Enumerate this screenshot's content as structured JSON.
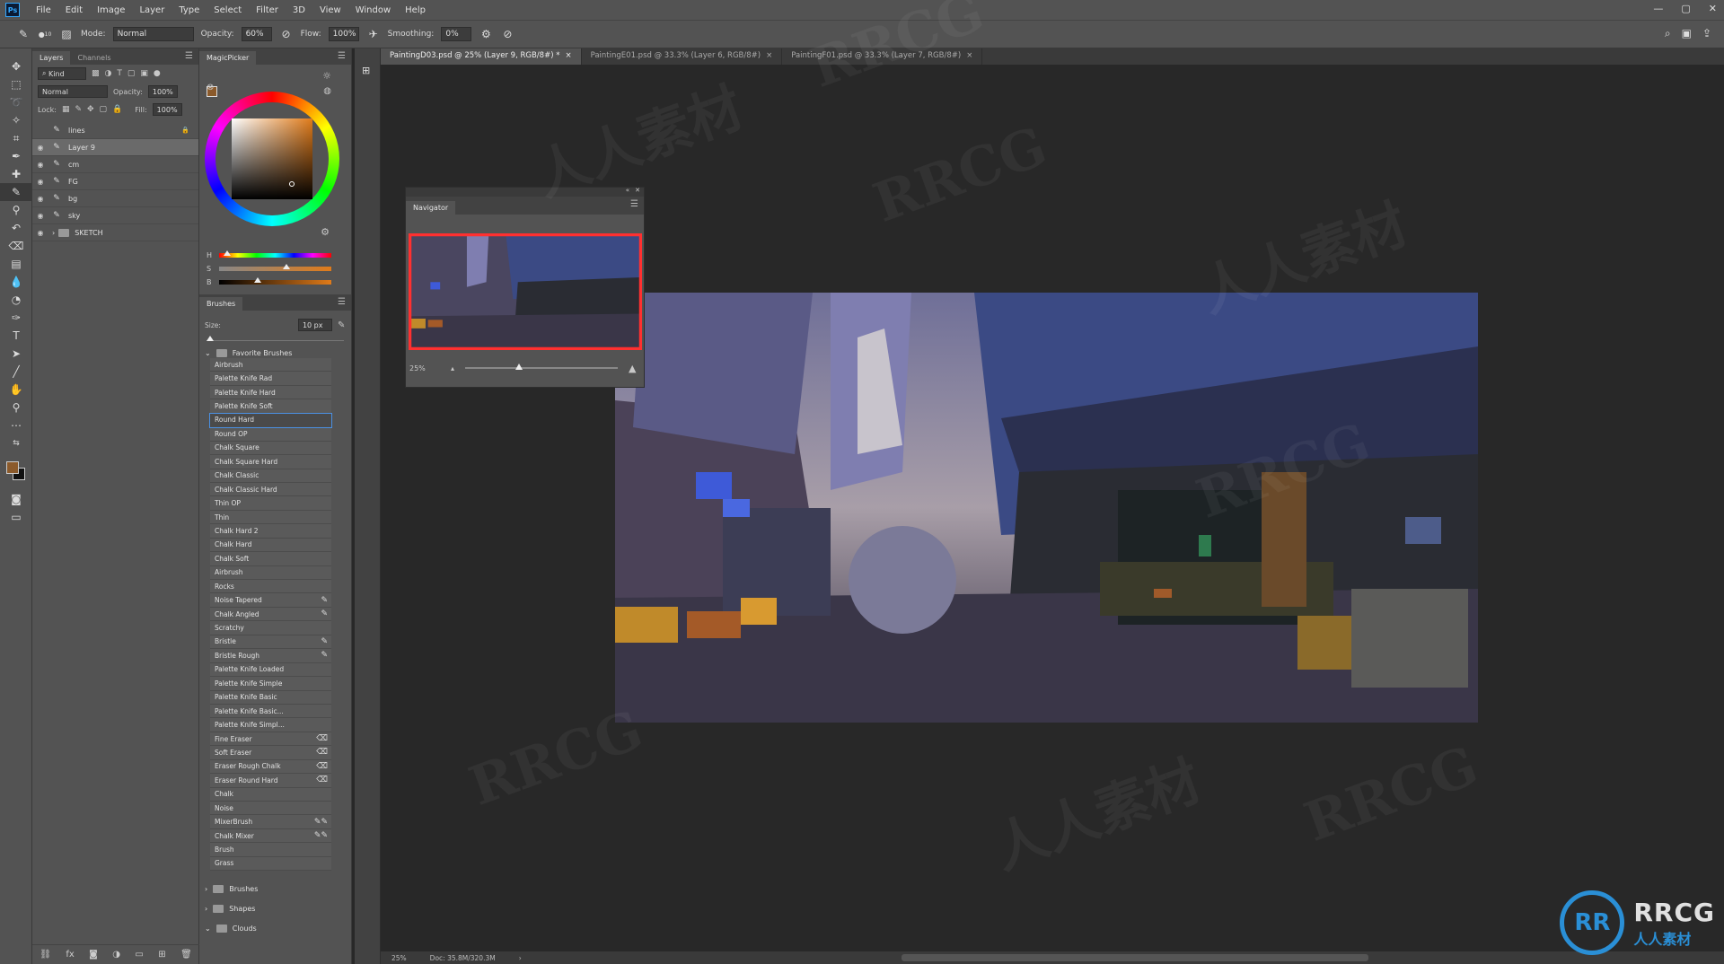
{
  "menu": {
    "app_logo": "Ps",
    "items": [
      "File",
      "Edit",
      "Image",
      "Layer",
      "Type",
      "Select",
      "Filter",
      "3D",
      "View",
      "Window",
      "Help"
    ]
  },
  "options": {
    "mode_label": "Mode:",
    "mode_value": "Normal",
    "opacity_label": "Opacity:",
    "opacity_value": "60%",
    "flow_label": "Flow:",
    "flow_value": "100%",
    "smoothing_label": "Smoothing:",
    "smoothing_value": "0%",
    "brush_size_badge": "10"
  },
  "layers_panel": {
    "tabs": [
      "Layers",
      "Channels"
    ],
    "kind_label": "Kind",
    "blend_mode": "Normal",
    "opacity_label": "Opacity:",
    "opacity_value": "100%",
    "lock_label": "Lock:",
    "fill_label": "Fill:",
    "fill_value": "100%",
    "layers": [
      {
        "name": "lines",
        "visible": false,
        "selected": false
      },
      {
        "name": "Layer 9",
        "visible": true,
        "selected": true
      },
      {
        "name": "cm",
        "visible": true,
        "selected": false
      },
      {
        "name": "FG",
        "visible": true,
        "selected": false
      },
      {
        "name": "bg",
        "visible": true,
        "selected": false
      },
      {
        "name": "sky",
        "visible": true,
        "selected": false
      },
      {
        "name": "SKETCH",
        "visible": true,
        "selected": false,
        "group": true
      }
    ]
  },
  "magic_picker": {
    "title": "MagicPicker",
    "foreground_color": "#8b5a2b",
    "hsb": [
      "H",
      "S",
      "B"
    ]
  },
  "brushes_panel": {
    "title": "Brushes",
    "size_label": "Size:",
    "size_value": "10 px",
    "group_open": "Favorite Brushes",
    "items": [
      {
        "name": "Airbrush",
        "icon": ""
      },
      {
        "name": "Palette Knife Rad",
        "icon": ""
      },
      {
        "name": "Palette Knife Hard",
        "icon": ""
      },
      {
        "name": "Palette Knife Soft",
        "icon": ""
      },
      {
        "name": "Round Hard",
        "icon": "",
        "selected": true
      },
      {
        "name": "Round OP",
        "icon": ""
      },
      {
        "name": "Chalk Square",
        "icon": ""
      },
      {
        "name": "Chalk Square Hard",
        "icon": ""
      },
      {
        "name": "Chalk Classic",
        "icon": ""
      },
      {
        "name": "Chalk Classic Hard",
        "icon": ""
      },
      {
        "name": "Thin OP",
        "icon": ""
      },
      {
        "name": "Thin",
        "icon": ""
      },
      {
        "name": "Chalk Hard 2",
        "icon": ""
      },
      {
        "name": "Chalk Hard",
        "icon": ""
      },
      {
        "name": "Chalk Soft",
        "icon": ""
      },
      {
        "name": "Airbrush",
        "icon": ""
      },
      {
        "name": "Rocks",
        "icon": ""
      },
      {
        "name": "Noise Tapered",
        "icon": "brush"
      },
      {
        "name": "Chalk Angled",
        "icon": "brush"
      },
      {
        "name": "Scratchy",
        "icon": ""
      },
      {
        "name": "Bristle",
        "icon": "brush"
      },
      {
        "name": "Bristle Rough",
        "icon": "brush"
      },
      {
        "name": "Palette Knife Loaded",
        "icon": ""
      },
      {
        "name": "Palette Knife Simple",
        "icon": ""
      },
      {
        "name": "Palette Knife Basic",
        "icon": ""
      },
      {
        "name": "Palette Knife Basic...",
        "icon": ""
      },
      {
        "name": "Palette Knife Simpl...",
        "icon": ""
      },
      {
        "name": "Fine Eraser",
        "icon": "eraser"
      },
      {
        "name": "Soft Eraser",
        "icon": "eraser"
      },
      {
        "name": "Eraser Rough Chalk",
        "icon": "eraser"
      },
      {
        "name": "Eraser Round Hard",
        "icon": "eraser"
      },
      {
        "name": "Chalk",
        "icon": ""
      },
      {
        "name": "Noise",
        "icon": ""
      },
      {
        "name": "MixerBrush",
        "icon": "mixer"
      },
      {
        "name": "Chalk Mixer",
        "icon": "mixer"
      },
      {
        "name": "Brush",
        "icon": ""
      },
      {
        "name": "Grass",
        "icon": ""
      }
    ],
    "groups_closed": [
      "Brushes",
      "Shapes",
      "Clouds"
    ]
  },
  "navigator": {
    "title": "Navigator",
    "zoom": "25%",
    "zoom_slider_fraction": 0.35
  },
  "documents": {
    "tabs": [
      {
        "label": "PaintingD03.psd @ 25% (Layer 9, RGB/8#) *",
        "active": true
      },
      {
        "label": "PaintingE01.psd @ 33.3% (Layer 6, RGB/8#)",
        "active": false
      },
      {
        "label": "PaintingF01.psd @ 33.3% (Layer 7, RGB/8#)",
        "active": false
      }
    ],
    "close_glyph": "×"
  },
  "status": {
    "zoom": "25%",
    "doc_info": "Doc: 35.8M/320.3M"
  },
  "watermark": {
    "text": "RRCG",
    "cn_text": "人人素材",
    "logo_badge": "RRCG",
    "logo_sub": "人人素材"
  },
  "colors": {
    "ui_panel": "#535353",
    "ui_dark": "#282828",
    "accent": "#31a8ff",
    "selection_outline": "#4b90e2"
  }
}
